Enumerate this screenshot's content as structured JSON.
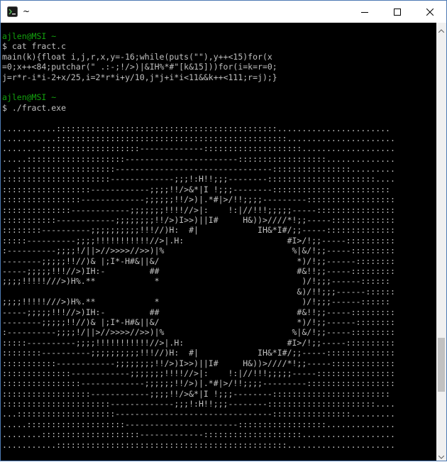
{
  "window": {
    "title": "~",
    "icons": {
      "app": "mintty-icon",
      "minimize": "minimize-icon",
      "maximize": "maximize-icon",
      "close": "close-icon"
    }
  },
  "scrollbar": {
    "thumb_position": 0.84,
    "thumb_size": 0.13
  },
  "terminal": {
    "colors": {
      "background": "#000000",
      "text": "#c0c0c0",
      "prompt_user": "#13a10e"
    },
    "lines": [
      {
        "kind": "prompt",
        "text": "ajlen@MSI ~"
      },
      {
        "kind": "text",
        "text": "$ cat fract.c"
      },
      {
        "kind": "text",
        "text": "main(k){float i,j,r,x,y=-16;while(puts(\"\"),y++<15)for(x"
      },
      {
        "kind": "text",
        "text": "=0;x++<84;putchar(\" .:-;!/>)|&IH%*#\"[k&15]))for(i=k=r=0;"
      },
      {
        "kind": "text",
        "text": "j=r*r-i*i-2+x/25,i=2*r*i+y/10,j*j+i*i<11&&k++<111;r=j);}"
      },
      {
        "kind": "blank",
        "text": ""
      },
      {
        "kind": "prompt",
        "text": "ajlen@MSI ~"
      },
      {
        "kind": "text",
        "text": "$ ./fract.exe"
      },
      {
        "kind": "blank",
        "text": ""
      },
      {
        "kind": "text",
        "text": "...........:::::::::::::::::::::::::::::::::::::::::::::......................."
      },
      {
        "kind": "text",
        "text": "...........:::::::::::::::::::::::::::::::::::::::::::::::......................"
      },
      {
        "kind": "text",
        "text": "........::::::::::::::::::::-------------::::::::::::::::::::..................."
      },
      {
        "kind": "text",
        "text": ".....::::::::::::::::::::-----------------------::::::::::::::::::.............."
      },
      {
        "kind": "text",
        "text": "...::::::::::::::::::::--------------------------------::::::::::::::::........."
      },
      {
        "kind": "text",
        "text": "::::::::::::::::::::::-------------;;;!:H!!;;;--------::::::::::::::::::::::...."
      },
      {
        "kind": "text",
        "text": "::::::::::::::::::------------;;;;!!/>&*|I !;;;--------::::::::::::::::::::::::"
      },
      {
        "kind": "text",
        "text": "::::::::::::::::-------------;;;;;;!!/>)|.*#|>/!!;;;;---------::::::::::::::::::"
      },
      {
        "kind": "text",
        "text": "::::::::::::::------------;;;;;;;!!!!//>|:    !:|//!!!;;;;;-----::::::::::::::::"
      },
      {
        "kind": "text",
        "text": ":::::::::::------------;;;;;;;;!!/>)I>>)||I#     H&))>////*!;;-----:::::::::::::"
      },
      {
        "kind": "text",
        "text": "::::::::----------;;;;;;;;;;!!!//)H:  #|            IH&*I#/;;-----::::::::::::::"
      },
      {
        "kind": "text",
        "text": ":::::----------;;;;!!!!!!!!!!!//>|.H:                     #I>/!;;-----::::::::::"
      },
      {
        "kind": "text",
        "text": ":----------;;;;!/||>//>>>>//>>)|%                          %|&/!;;-----:::::::::"
      },
      {
        "kind": "text",
        "text": "--------;;;;;!!//)& |;I*-H#&||&/                            *)/!;;------::::::::"
      },
      {
        "kind": "text",
        "text": "-----;;;;;!!!//>)IH:-         ##                            #&!!;;-----:::::::::"
      },
      {
        "kind": "text",
        "text": ";;;;!!!!!///>)H%.**            *                             )/!;;;------::::::"
      },
      {
        "kind": "text",
        "text": "                                                            &)/!!;;;------::::::"
      },
      {
        "kind": "text",
        "text": ";;;;!!!!!///>)H%.**            *                             )/!;;;------::::::"
      },
      {
        "kind": "text",
        "text": "-----;;;;;!!!//>)IH:-         ##                            #&!!;;-----:::::::::"
      },
      {
        "kind": "text",
        "text": "--------;;;;;!!//)& |;I*-H#&||&/                            *)/!;;------::::::::"
      },
      {
        "kind": "text",
        "text": ":----------;;;;!/||>//>>>>//>>)|%                          %|&/!;;-----:::::::::"
      },
      {
        "kind": "text",
        "text": ":::::----------;;;;!!!!!!!!!!!//>|.H:                     #I>/!;;-----::::::::::"
      },
      {
        "kind": "text",
        "text": "::::::::----------;;;;;;;;;;!!!//)H:  #|            IH&*I#/;;-----::::::::::::::"
      },
      {
        "kind": "text",
        "text": ":::::::::::------------;;;;;;;;!!/>)I>>)||I#     H&))>////*!;;-----:::::::::::::"
      },
      {
        "kind": "text",
        "text": "::::::::::::::------------;;;;;;;!!!!//>|:    !:|//!!!;;;;;-----::::::::::::::::"
      },
      {
        "kind": "text",
        "text": "::::::::::::::::-------------;;;;;;!!/>)|.*#|>/!!;;;;---------::::::::::::::::::"
      },
      {
        "kind": "text",
        "text": "::::::::::::::::::------------;;;;!!/>&*|I !;;;--------::::::::::::::::::::::::"
      },
      {
        "kind": "text",
        "text": "::::::::::::::::::::::-------------;;;!:H!!;;;--------::::::::::::::::::::::...."
      },
      {
        "kind": "text",
        "text": "...::::::::::::::::::::--------------------------------::::::::::::::::........."
      },
      {
        "kind": "text",
        "text": ".....::::::::::::::::::::-----------------------::::::::::::::::::.............."
      },
      {
        "kind": "text",
        "text": "........::::::::::::::::::::-------------::::::::::::::::::::..................."
      },
      {
        "kind": "text",
        "text": "...........:::::::::::::::::::::::::::::::::::::::::::::::......................"
      },
      {
        "kind": "blank",
        "text": ""
      },
      {
        "kind": "prompt",
        "text": "ajlen@MSI ~"
      },
      {
        "kind": "text",
        "text": "$ "
      }
    ]
  }
}
